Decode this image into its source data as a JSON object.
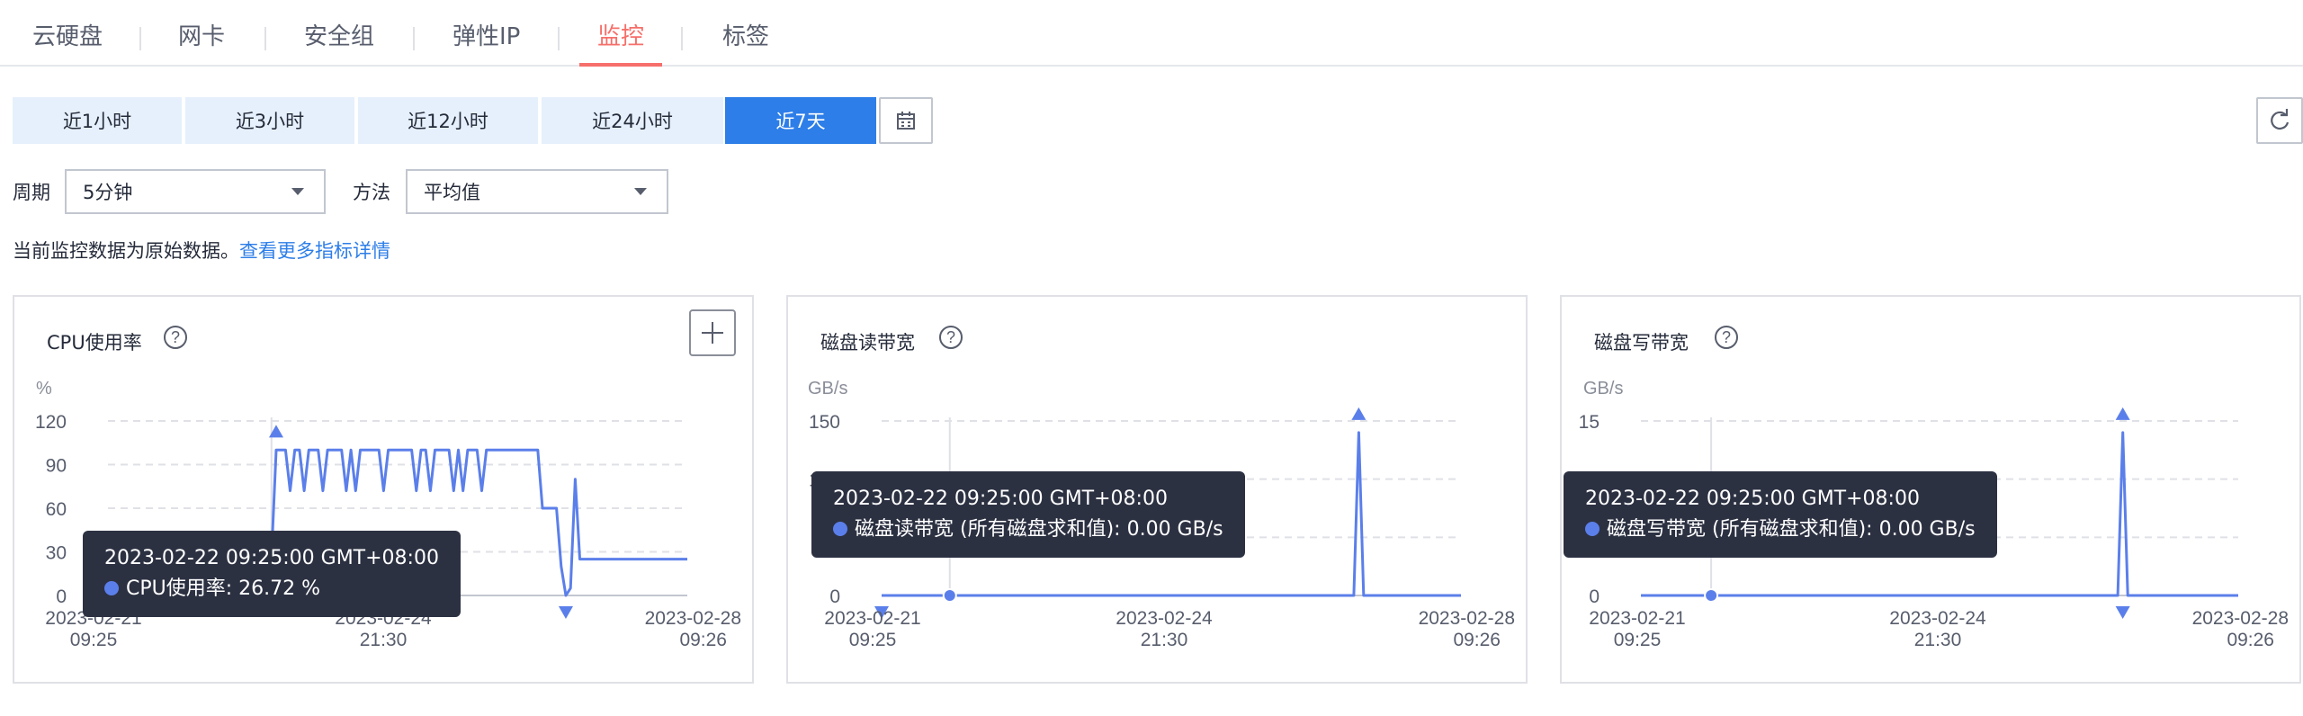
{
  "tabs": [
    "云硬盘",
    "网卡",
    "安全组",
    "弹性IP",
    "监控",
    "标签"
  ],
  "active_tab": "监控",
  "time_ranges": [
    "近1小时",
    "近3小时",
    "近12小时",
    "近24小时",
    "近7天"
  ],
  "active_range": "近7天",
  "filters": {
    "period_label": "周期",
    "period_value": "5分钟",
    "method_label": "方法",
    "method_value": "平均值"
  },
  "note": {
    "text": "当前监控数据为原始数据。",
    "link": "查看更多指标详情"
  },
  "colors": {
    "accent": "#2d7ee8",
    "active_tab": "#f66f6a",
    "series": "#5b7fea",
    "tooltip_bg": "#2c3142"
  },
  "icons": [
    "calendar-icon",
    "refresh-icon",
    "help-icon",
    "expand-icon",
    "triangle-up-marker",
    "triangle-down-marker"
  ],
  "chart_data": [
    {
      "type": "line",
      "title": "CPU使用率",
      "unit": "%",
      "yticks": [
        0,
        30,
        60,
        90,
        120
      ],
      "ylim": [
        0,
        120
      ],
      "x_labels": [
        {
          "date": "2023-02-21",
          "time": "09:25"
        },
        {
          "date": "2023-02-24",
          "time": "21:30"
        },
        {
          "date": "2023-02-28",
          "time": "09:26"
        }
      ],
      "series": [
        {
          "name": "CPU使用率",
          "values": [
            0,
            0,
            0,
            0,
            0,
            0,
            0,
            0,
            0,
            0,
            0,
            0,
            0,
            0,
            0,
            0,
            0,
            0,
            0,
            0,
            0,
            0,
            0,
            0,
            0,
            0,
            0,
            0,
            0,
            0,
            0,
            0,
            0,
            0,
            0,
            26.72,
            100,
            100,
            100,
            72,
            100,
            100,
            72,
            100,
            100,
            100,
            72,
            100,
            100,
            100,
            100,
            72,
            100,
            72,
            100,
            100,
            100,
            100,
            100,
            72,
            100,
            100,
            100,
            100,
            100,
            100,
            72,
            100,
            100,
            72,
            100,
            100,
            100,
            100,
            72,
            100,
            72,
            100,
            100,
            100,
            72,
            100,
            100,
            100,
            100,
            100,
            100,
            100,
            100,
            100,
            100,
            100,
            100,
            60,
            60,
            60,
            60,
            20,
            0,
            5,
            80,
            25,
            25,
            25,
            25,
            25,
            25,
            25,
            25,
            25,
            25,
            25,
            25,
            25,
            25,
            25,
            25,
            25,
            25,
            25,
            25,
            25,
            25,
            25,
            25
          ]
        }
      ],
      "tooltip": {
        "time": "2023-02-22 09:25:00 GMT+08:00",
        "series": "CPU使用率",
        "value": "26.72 %"
      },
      "max_marker_index": 36,
      "min_marker_index": 98
    },
    {
      "type": "line",
      "title": "磁盘读带宽",
      "unit": "GB/s",
      "yticks": [
        0,
        50,
        100,
        150
      ],
      "ylim": [
        0,
        150
      ],
      "x_labels": [
        {
          "date": "2023-02-21",
          "time": "09:25"
        },
        {
          "date": "2023-02-24",
          "time": "21:30"
        },
        {
          "date": "2023-02-28",
          "time": "09:26"
        }
      ],
      "series": [
        {
          "name": "磁盘读带宽 (所有磁盘求和值)",
          "values": [
            0,
            0,
            0,
            0,
            0,
            0,
            0,
            0,
            0,
            0,
            0,
            0,
            0,
            0,
            0,
            0,
            0,
            0,
            0,
            0,
            0,
            0,
            0,
            0,
            0,
            0,
            0,
            0,
            0,
            0,
            0,
            0,
            0,
            0,
            0,
            0,
            0,
            0,
            0,
            0,
            0,
            0,
            0,
            0,
            0,
            0,
            0,
            0,
            0,
            0,
            0,
            0,
            0,
            0,
            0,
            0,
            0,
            0,
            0,
            0,
            0,
            0,
            0,
            0,
            0,
            0,
            0,
            0,
            0,
            0,
            0,
            0,
            0,
            0,
            0,
            0,
            0,
            0,
            0,
            0,
            0,
            0,
            0,
            0,
            0,
            0,
            0,
            0,
            0,
            0,
            0,
            0,
            0,
            0,
            0,
            0,
            0,
            0,
            0,
            0,
            0,
            0,
            0,
            0,
            0,
            0,
            0,
            0,
            0,
            0,
            0,
            0,
            0,
            0,
            0,
            0,
            0,
            0,
            0,
            0
          ]
        }
      ],
      "tooltip": {
        "time": "2023-02-22 09:25:00 GMT+08:00",
        "series": "磁盘读带宽 (所有磁盘求和值)",
        "value": "0.00 GB/s"
      },
      "spike": {
        "index": 98,
        "value": 140
      },
      "max_marker_index": 98,
      "min_marker_index": 0,
      "hover_index": 14
    },
    {
      "type": "line",
      "title": "磁盘写带宽",
      "unit": "GB/s",
      "yticks": [
        0,
        5,
        10,
        15
      ],
      "ylim": [
        0,
        15
      ],
      "x_labels": [
        {
          "date": "2023-02-21",
          "time": "09:25"
        },
        {
          "date": "2023-02-24",
          "time": "21:30"
        },
        {
          "date": "2023-02-28",
          "time": "09:26"
        }
      ],
      "series": [
        {
          "name": "磁盘写带宽 (所有磁盘求和值)",
          "values": [
            0,
            0,
            0,
            0,
            0,
            0,
            0,
            0,
            0,
            0,
            0,
            0,
            0,
            0,
            0,
            0,
            0,
            0,
            0,
            0,
            0,
            0,
            0,
            0,
            0,
            0,
            0,
            0,
            0,
            0,
            0,
            0,
            0,
            0,
            0,
            0,
            0,
            0,
            0,
            0,
            0,
            0,
            0,
            0,
            0,
            0,
            0,
            0,
            0,
            0,
            0,
            0,
            0,
            0,
            0,
            0,
            0,
            0,
            0,
            0,
            0,
            0,
            0,
            0,
            0,
            0,
            0,
            0,
            0,
            0,
            0,
            0,
            0,
            0,
            0,
            0,
            0,
            0,
            0,
            0,
            0,
            0,
            0,
            0,
            0,
            0,
            0,
            0,
            0,
            0,
            0,
            0,
            0,
            0,
            0,
            0,
            0,
            0,
            0,
            0,
            0,
            0,
            0,
            0,
            0,
            0,
            0,
            0,
            0,
            0,
            0,
            0,
            0,
            0,
            0,
            0,
            0,
            0,
            0,
            0
          ]
        }
      ],
      "tooltip": {
        "time": "2023-02-22 09:25:00 GMT+08:00",
        "series": "磁盘写带宽 (所有磁盘求和值)",
        "value": "0.00 GB/s"
      },
      "spike": {
        "index": 96,
        "value": 14
      },
      "max_marker_index": 96,
      "min_marker_index": 96,
      "hover_index": 14
    }
  ]
}
